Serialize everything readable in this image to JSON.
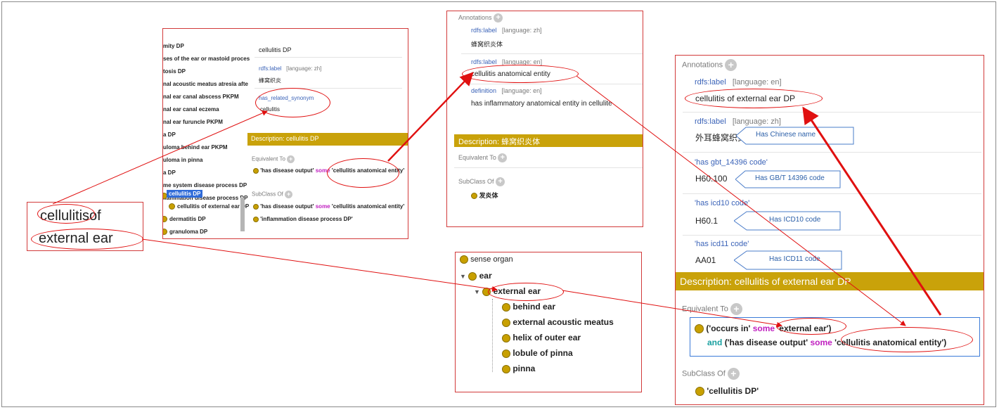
{
  "left_label": {
    "line1a": "cellulitis",
    "line1b": "of",
    "line2": "external ear"
  },
  "panel_a": {
    "tree": [
      {
        "label": "mity DP"
      },
      {
        "label": "ses of the ear or mastoid proces"
      },
      {
        "label": "tosis DP"
      },
      {
        "label": "nal acoustic meatus atresia afte"
      },
      {
        "label": "nal ear canal abscess PKPM"
      },
      {
        "label": "nal ear canal eczema"
      },
      {
        "label": "nal ear furuncle PKPM"
      },
      {
        "label": "a DP"
      },
      {
        "label": "uloma behind ear PKPM"
      },
      {
        "label": "uloma in pinna"
      },
      {
        "label": "a DP"
      },
      {
        "label": "me system disease process DP"
      },
      {
        "label": "flammation disease process DP"
      }
    ],
    "tree_selected": "cellulitis DP",
    "tree_child": "cellulitis of external ear DP",
    "tree_after": [
      {
        "label": "dermatitis DP"
      },
      {
        "label": "granuloma DP"
      }
    ],
    "annotations": [
      {
        "value": "cellulitis DP"
      },
      {
        "prop": "rdfs:label",
        "lang": "[language: zh]",
        "value": "蜂窝织炎"
      },
      {
        "prop": "has_related_synonym",
        "value": "cellulitis"
      }
    ],
    "description": "Description: cellulitis DP",
    "equivalent_to": "Equivalent To",
    "eq_p1": "'has disease output'",
    "eq_kw": "some",
    "eq_p2": "'cellulitis anatomical entity'",
    "subclass_of": "SubClass Of",
    "sub_p1": "'has disease output'",
    "sub_kw": "some",
    "sub_p2": "'cellulitis anatomical entity'",
    "sub2": "'inflammation disease process DP'"
  },
  "panel_b": {
    "annotations_title": "Annotations",
    "label1_prop": "rdfs:label",
    "label1_lang": "[language: zh]",
    "label1_value": "蜂窝织炎体",
    "label2_prop": "rdfs:label",
    "label2_lang": "[language: en]",
    "label2_value": "cellulitis anatomical entity",
    "def_prop": "definition",
    "def_lang": "[language: en]",
    "def_value": "has inflammatory anatomical entity  in cellulite",
    "description": "Description: 蜂窝织炎体",
    "equivalent_to": "Equivalent To",
    "subclass_of": "SubClass Of",
    "subclass_value": "发炎体"
  },
  "panel_c": {
    "items": [
      {
        "label": "sense organ"
      },
      {
        "label": "ear"
      },
      {
        "label": "external ear"
      },
      {
        "label": "behind ear"
      },
      {
        "label": "external acoustic meatus"
      },
      {
        "label": "helix of outer ear"
      },
      {
        "label": "lobule of pinna"
      },
      {
        "label": "pinna"
      }
    ]
  },
  "panel_d": {
    "annotations_title": "Annotations",
    "label_en_prop": "rdfs:label",
    "label_en_lang": "[language: en]",
    "label_en_value": "cellulitis of external ear DP",
    "label_zh_prop": "rdfs:label",
    "label_zh_lang": "[language: zh]",
    "label_zh_value": "外耳蜂窝织炎",
    "callout_zh": "Has Chinese name",
    "gbt_prop": "'has gbt_14396 code'",
    "gbt_value": "H60.100",
    "callout_gbt": "Has GB/T 14396 code",
    "icd10_prop": "'has icd10 code'",
    "icd10_value": "H60.1",
    "callout_icd10": "Has ICD10 code",
    "icd11_prop": "'has icd11 code'",
    "icd11_value": "AA01",
    "callout_icd11": "Has ICD11 code",
    "description": "Description: cellulitis of external ear DP",
    "equivalent_to": "Equivalent To",
    "eq_open": "('occurs in'",
    "eq_kw1": "some",
    "eq_target1": "'external ear')",
    "eq_and": "and",
    "eq_open2": "('has disease output'",
    "eq_kw2": "some",
    "eq_target2": "'cellulitis anatomical entity')",
    "subclass_of": "SubClass Of",
    "subclass_value": "'cellulitis DP'"
  },
  "colors": {
    "accent": "#c9a20a",
    "annotation_red": "#e01010",
    "keyword": "#c020c0",
    "keyword_and": "#19a0a0",
    "property_blue": "#3b63b8",
    "callout_blue": "#2b5fa8"
  },
  "icons": {
    "class": "gold-circle-icon",
    "add": "plus-circle-icon",
    "expand": "triangle-down-icon"
  }
}
